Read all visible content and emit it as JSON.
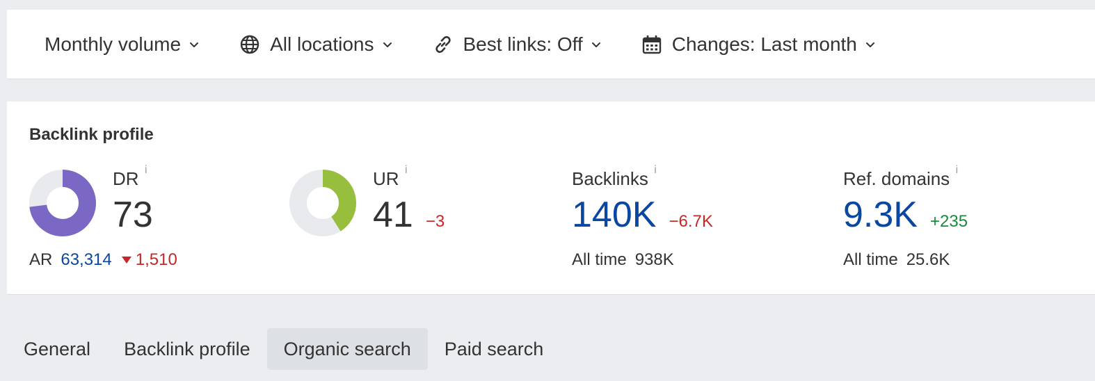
{
  "filters": [
    {
      "label": "Monthly volume",
      "icon": "none"
    },
    {
      "label": "All locations",
      "icon": "globe-icon"
    },
    {
      "label": "Best links: Off",
      "icon": "link-icon"
    },
    {
      "label": "Changes: Last month",
      "icon": "calendar-icon"
    }
  ],
  "card": {
    "title": "Backlink profile",
    "dr": {
      "label": "DR",
      "info": "i",
      "value": "73",
      "donut_fraction": 0.73,
      "color": "#7b68c4"
    },
    "ar": {
      "label": "AR",
      "value": "63,314",
      "delta": "1,510"
    },
    "ur": {
      "label": "UR",
      "info": "i",
      "value": "41",
      "delta": "−3",
      "donut_fraction": 0.41,
      "color": "#97bf3d"
    },
    "backlinks": {
      "label": "Backlinks",
      "info": "i",
      "value": "140K",
      "delta": "−6.7K",
      "alltime_label": "All time",
      "alltime_value": "938K"
    },
    "refdomains": {
      "label": "Ref. domains",
      "info": "i",
      "value": "9.3K",
      "delta": "+235",
      "alltime_label": "All time",
      "alltime_value": "25.6K"
    }
  },
  "tabs": [
    {
      "label": "General",
      "active": false
    },
    {
      "label": "Backlink profile",
      "active": false
    },
    {
      "label": "Organic search",
      "active": true
    },
    {
      "label": "Paid search",
      "active": false
    }
  ],
  "colors": {
    "accent_blue": "#0a47a0",
    "negative": "#c62828",
    "positive": "#1b8a3e"
  }
}
